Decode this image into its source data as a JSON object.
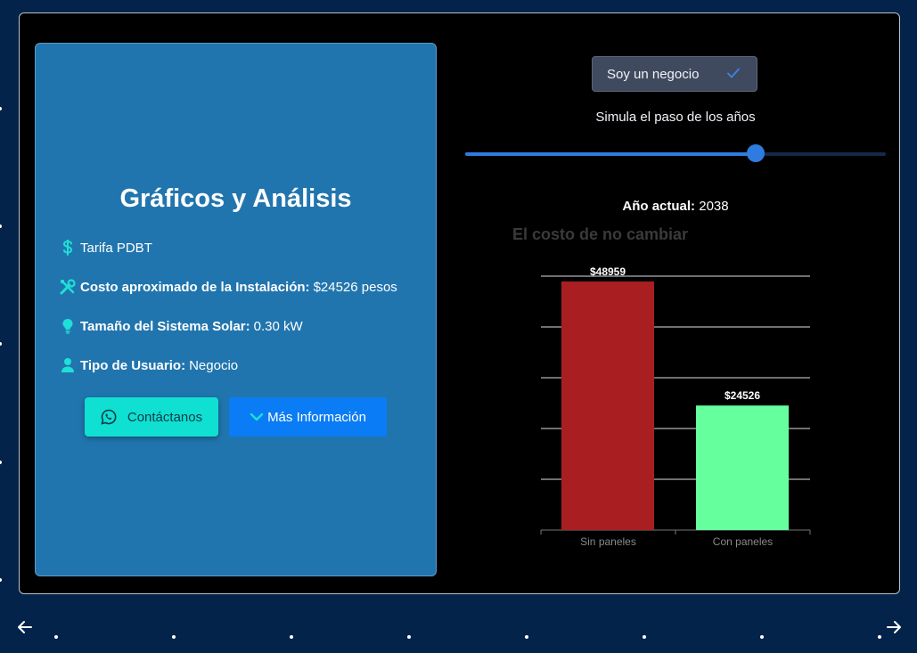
{
  "info": {
    "title": "Gráficos y Análisis",
    "tarifa": "Tarifa PDBT",
    "costo_label": "Costo aproximado de la Instalación:",
    "costo_value": "$24526 pesos",
    "tamano_label": "Tamaño del Sistema Solar:",
    "tamano_value": "0.30 kW",
    "tipo_label": "Tipo de Usuario:",
    "tipo_value": "Negocio",
    "contact_button": "Contáctanos",
    "more_button": "Más Información",
    "icons": [
      "dollar-icon",
      "tools-icon",
      "lightbulb-icon",
      "user-icon",
      "whatsapp-icon",
      "chevron-down-icon"
    ]
  },
  "toggle": {
    "label": "Soy un negocio",
    "checked": true,
    "icon": "check-icon"
  },
  "slider": {
    "label": "Simula el paso de los años",
    "value_fraction": 0.69
  },
  "year": {
    "label": "Año actual:",
    "value": "2038"
  },
  "colors": {
    "accent": "#2f7ce0",
    "card": "#2175ae",
    "bar_sin": "#a91f21",
    "bar_con": "#66ff9e",
    "contact": "#0fe0d2",
    "more": "#0a7cf5"
  },
  "chart_data": {
    "type": "bar",
    "title": "El costo de no cambiar",
    "categories": [
      "Sin paneles",
      "Con paneles"
    ],
    "values": [
      48959,
      24526
    ],
    "value_labels": [
      "$48959",
      "$24526"
    ],
    "ylim": [
      0,
      50000
    ],
    "grid": true
  },
  "nav": {
    "prev_icon": "arrow-left-icon",
    "next_icon": "arrow-right-icon"
  }
}
